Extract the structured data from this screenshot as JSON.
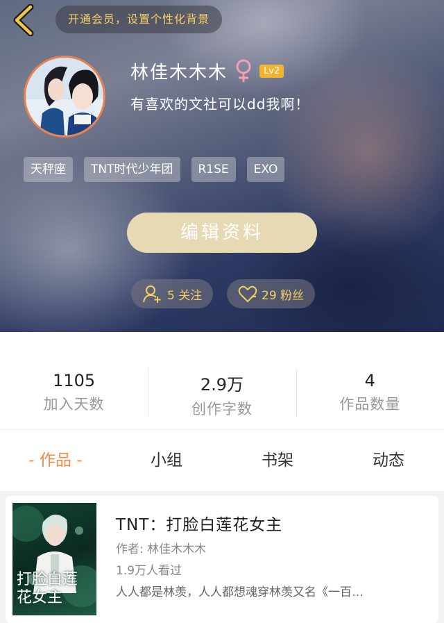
{
  "header": {
    "back_icon": "chevron-left-icon",
    "vip_prompt": "开通会员，设置个性化背景"
  },
  "profile": {
    "name": "林佳木木木",
    "gender_icon": "female-icon",
    "level": "Lv2",
    "bio": "有喜欢的文社可以dd我啊！",
    "tags": [
      "天秤座",
      "TNT时代少年团",
      "R1SE",
      "EXO"
    ],
    "edit_label": "编辑资料",
    "following_text": "5 关注",
    "followers_text": "29 粉丝"
  },
  "stats": [
    {
      "value": "1105",
      "label": "加入天数"
    },
    {
      "value": "2.9万",
      "label": "创作字数"
    },
    {
      "value": "4",
      "label": "作品数量"
    }
  ],
  "tabs": [
    {
      "label": "- 作品 -",
      "active": true
    },
    {
      "label": "小组",
      "active": false
    },
    {
      "label": "书架",
      "active": false
    },
    {
      "label": "动态",
      "active": false
    }
  ],
  "works": [
    {
      "title": "TNT：打脸白莲花女主",
      "author": "作者: 林佳木木木",
      "views": "1.9万人看过",
      "description": "人人都是林羡，人人都想魂穿林羡又名《一百…",
      "cover_text": "打脸白莲花女主"
    }
  ],
  "colors": {
    "accent_orange": "#f08a47",
    "vip_gold": "#f3cf62",
    "edit_button": "#e6d9b3",
    "level_badge": "#f2b32e",
    "avatar_ring": "#e9834e"
  }
}
